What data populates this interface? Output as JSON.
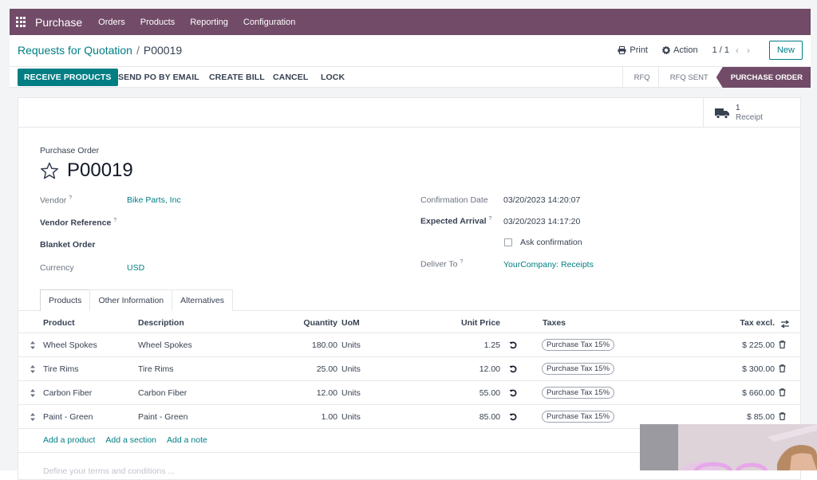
{
  "navbar": {
    "app_name": "Purchase",
    "menu": [
      "Orders",
      "Products",
      "Reporting",
      "Configuration"
    ]
  },
  "control_panel": {
    "breadcrumb_parent": "Requests for Quotation",
    "breadcrumb_current": "P00019",
    "print_label": "Print",
    "action_label": "Action",
    "pager": "1 / 1",
    "new_label": "New"
  },
  "statusbar": {
    "buttons": [
      "RECEIVE PRODUCTS",
      "SEND PO BY EMAIL",
      "CREATE BILL",
      "CANCEL",
      "LOCK"
    ],
    "stages": [
      "RFQ",
      "RFQ SENT",
      "PURCHASE ORDER"
    ],
    "active_stage": "PURCHASE ORDER"
  },
  "smart_button": {
    "count": "1",
    "label": "Receipt"
  },
  "form": {
    "title_label": "Purchase Order",
    "name": "P00019",
    "left_fields": [
      {
        "label": "Vendor",
        "help": "?",
        "value": "Bike Parts, Inc"
      },
      {
        "label": "Vendor Reference",
        "help": "?",
        "value": ""
      },
      {
        "label": "Blanket Order",
        "help": "",
        "value": ""
      },
      {
        "label": "Currency",
        "help": "",
        "value": "USD"
      }
    ],
    "right_fields": [
      {
        "label": "Confirmation Date",
        "help": "",
        "value": "03/20/2023 14:20:07"
      },
      {
        "label": "Expected Arrival",
        "help": "?",
        "value": "03/20/2023 14:17:20"
      },
      {
        "label": "",
        "help": "",
        "value": "Ask confirmation"
      },
      {
        "label": "Deliver To",
        "help": "?",
        "value": "YourCompany: Receipts"
      }
    ]
  },
  "tabs": [
    "Products",
    "Other Information",
    "Alternatives"
  ],
  "table": {
    "headers": {
      "product": "Product",
      "description": "Description",
      "quantity": "Quantity",
      "uom": "UoM",
      "unit_price": "Unit Price",
      "taxes": "Taxes",
      "tax_excl": "Tax excl."
    },
    "rows": [
      {
        "product": "Wheel Spokes",
        "description": "Wheel Spokes",
        "quantity": "180.00",
        "uom": "Units",
        "unit_price": "1.25",
        "tax": "Purchase Tax 15%",
        "subtotal": "$ 225.00"
      },
      {
        "product": "Tire Rims",
        "description": "Tire Rims",
        "quantity": "25.00",
        "uom": "Units",
        "unit_price": "12.00",
        "tax": "Purchase Tax 15%",
        "subtotal": "$ 300.00"
      },
      {
        "product": "Carbon Fiber",
        "description": "Carbon Fiber",
        "quantity": "12.00",
        "uom": "Units",
        "unit_price": "55.00",
        "tax": "Purchase Tax 15%",
        "subtotal": "$ 660.00"
      },
      {
        "product": "Paint - Green",
        "description": "Paint - Green",
        "quantity": "1.00",
        "uom": "Units",
        "unit_price": "85.00",
        "tax": "Purchase Tax 15%",
        "subtotal": "$ 85.00"
      }
    ],
    "add_links": [
      "Add a product",
      "Add a section",
      "Add a note"
    ]
  },
  "notes_placeholder": "Define your terms and conditions ...",
  "colors": {
    "brand": "#714b67",
    "accent": "#017e84"
  }
}
